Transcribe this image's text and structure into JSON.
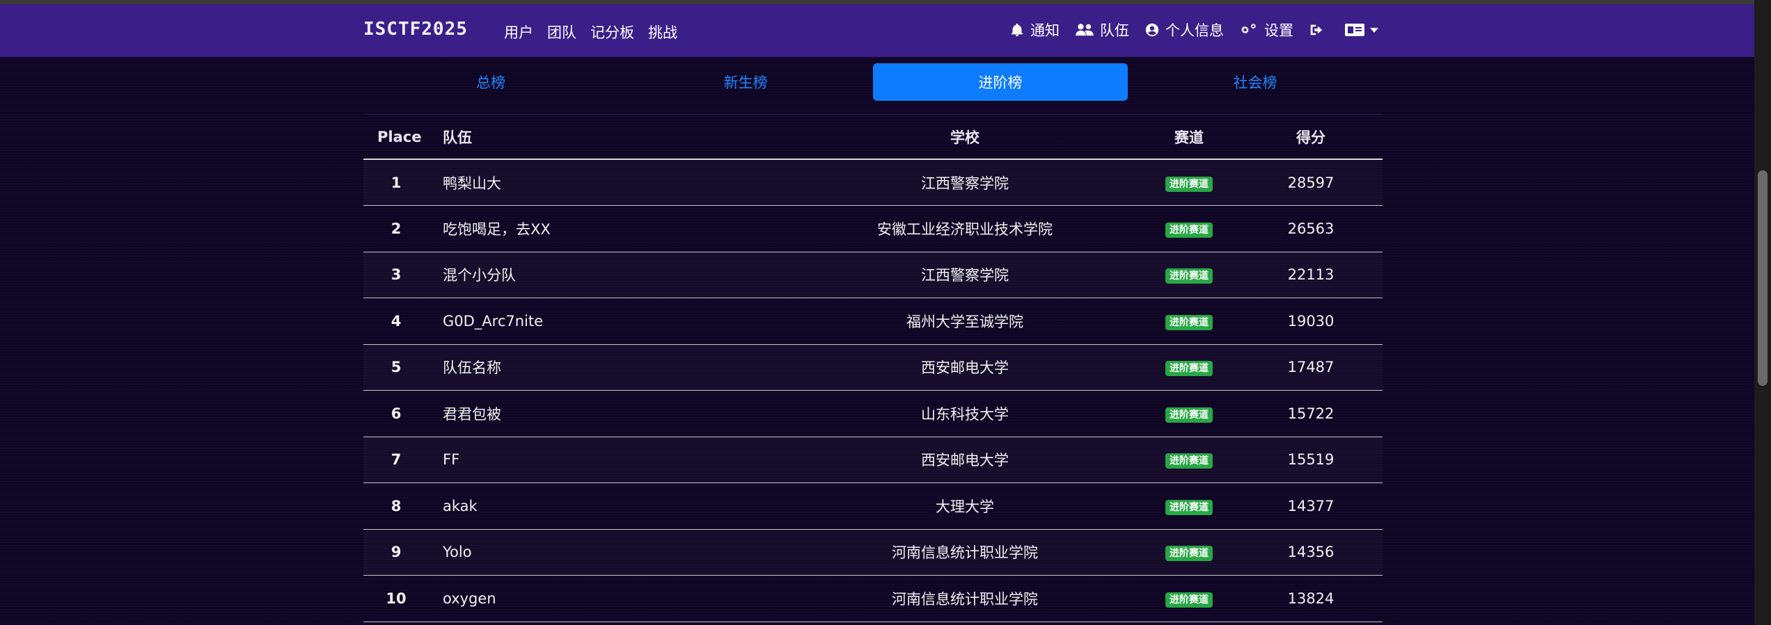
{
  "nav": {
    "brand": "ISCTF2025",
    "left_links": [
      "用户",
      "团队",
      "记分板",
      "挑战"
    ],
    "notifications": "通知",
    "team": "队伍",
    "profile": "个人信息",
    "settings": "设置"
  },
  "tabs": [
    {
      "label": "总榜",
      "active": false
    },
    {
      "label": "新生榜",
      "active": false
    },
    {
      "label": "进阶榜",
      "active": true
    },
    {
      "label": "社会榜",
      "active": false
    }
  ],
  "table": {
    "headers": {
      "place": "Place",
      "team": "队伍",
      "school": "学校",
      "track": "赛道",
      "score": "得分"
    },
    "rows": [
      {
        "place": "1",
        "team": "鸭梨山大",
        "school": "江西警察学院",
        "track": "进阶赛道",
        "score": "28597"
      },
      {
        "place": "2",
        "team": "吃饱喝足，去XX",
        "school": "安徽工业经济职业技术学院",
        "track": "进阶赛道",
        "score": "26563"
      },
      {
        "place": "3",
        "team": "混个小分队",
        "school": "江西警察学院",
        "track": "进阶赛道",
        "score": "22113"
      },
      {
        "place": "4",
        "team": "G0D_Arc7nite",
        "school": "福州大学至诚学院",
        "track": "进阶赛道",
        "score": "19030"
      },
      {
        "place": "5",
        "team": "队伍名称",
        "school": "西安邮电大学",
        "track": "进阶赛道",
        "score": "17487"
      },
      {
        "place": "6",
        "team": "君君包被",
        "school": "山东科技大学",
        "track": "进阶赛道",
        "score": "15722"
      },
      {
        "place": "7",
        "team": "FF",
        "school": "西安邮电大学",
        "track": "进阶赛道",
        "score": "15519"
      },
      {
        "place": "8",
        "team": "akak",
        "school": "大理大学",
        "track": "进阶赛道",
        "score": "14377"
      },
      {
        "place": "9",
        "team": "Yolo",
        "school": "河南信息统计职业学院",
        "track": "进阶赛道",
        "score": "14356"
      },
      {
        "place": "10",
        "team": "oxygen",
        "school": "河南信息统计职业学院",
        "track": "进阶赛道",
        "score": "13824"
      }
    ]
  },
  "colors": {
    "navbar": "#3a1f88",
    "background": "#0f0525",
    "active_tab": "#0d7cff",
    "tab_link": "#1e88ff",
    "badge": "#28a745"
  }
}
